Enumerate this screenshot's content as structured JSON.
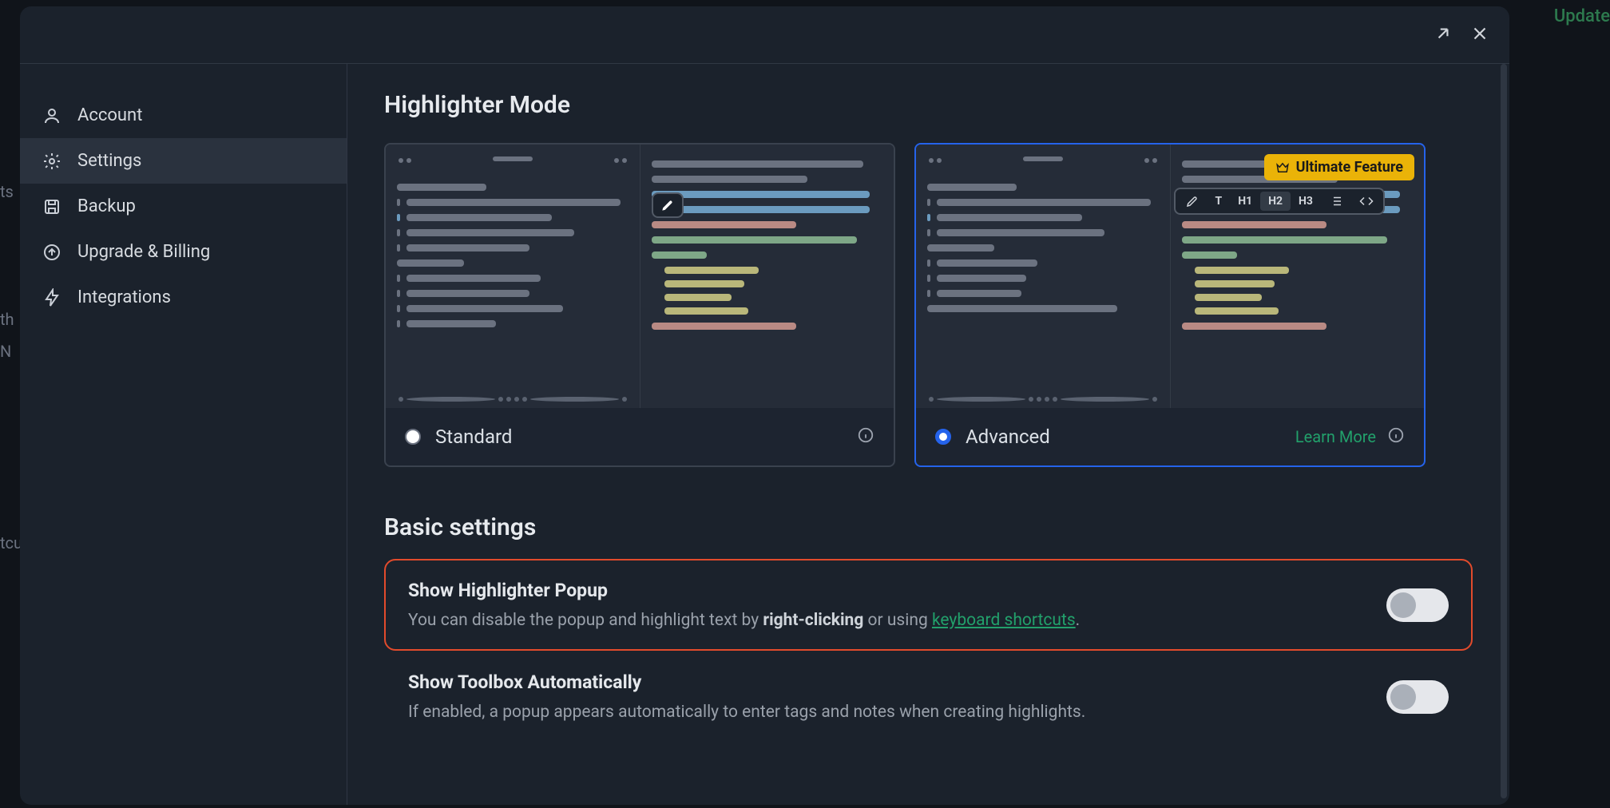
{
  "bg": {
    "update": "Update",
    "shadow1": "ts",
    "shadow2": "th",
    "shadow3": "N",
    "shadow4": "tcu"
  },
  "sidebar": {
    "items": [
      {
        "label": "Account"
      },
      {
        "label": "Settings"
      },
      {
        "label": "Backup"
      },
      {
        "label": "Upgrade & Billing"
      },
      {
        "label": "Integrations"
      }
    ]
  },
  "highlighter": {
    "title": "Highlighter Mode",
    "standard": {
      "label": "Standard"
    },
    "advanced": {
      "label": "Advanced",
      "learn_more": "Learn More",
      "badge": "Ultimate Feature"
    },
    "toolbar": {
      "t": "T",
      "h1": "H1",
      "h2": "H2",
      "h3": "H3"
    }
  },
  "basic": {
    "title": "Basic settings",
    "popup": {
      "title": "Show Highlighter Popup",
      "desc_pre": "You can disable the popup and highlight text by ",
      "desc_strong1": "right-clicking",
      "desc_mid": " or using ",
      "desc_link": "keyboard shortcuts",
      "desc_post": "."
    },
    "toolbox": {
      "title": "Show Toolbox Automatically",
      "desc": "If enabled, a popup appears automatically to enter tags and notes when creating highlights."
    }
  }
}
